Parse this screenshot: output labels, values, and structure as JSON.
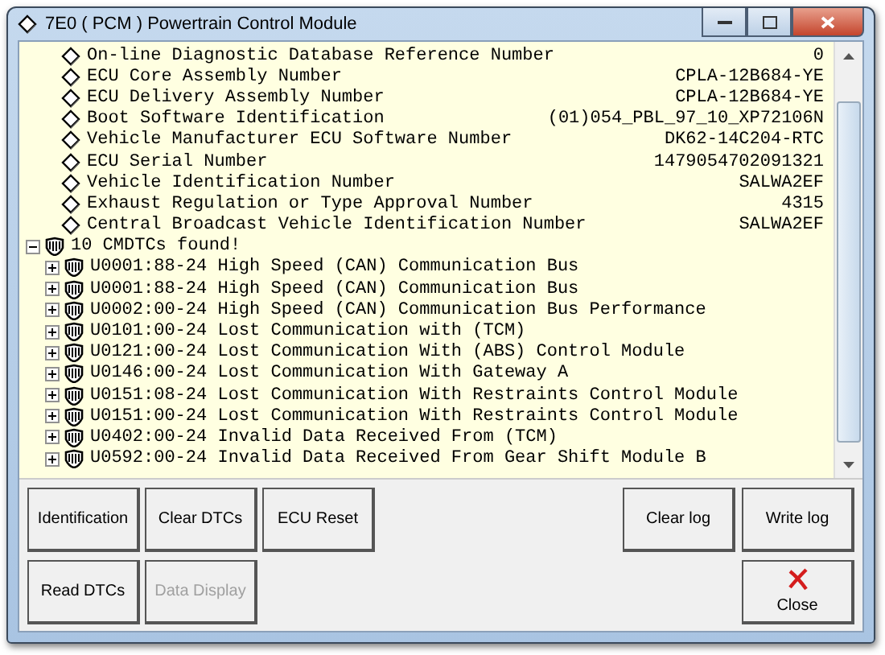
{
  "window": {
    "title": "7E0 ( PCM ) Powertrain Control Module"
  },
  "identification": [
    {
      "label": "On-line Diagnostic Database Reference Number",
      "value": "0"
    },
    {
      "label": "ECU Core Assembly Number",
      "value": "CPLA-12B684-YE"
    },
    {
      "label": "ECU Delivery Assembly Number",
      "value": "CPLA-12B684-YE"
    },
    {
      "label": "Boot Software Identification",
      "value": "(01)054_PBL_97_10_XP72106N"
    },
    {
      "label": "Vehicle Manufacturer ECU Software Number",
      "value": "DK62-14C204-RTC"
    },
    {
      "label": "ECU Serial Number",
      "value": "1479054702091321"
    },
    {
      "label": "Vehicle Identification Number",
      "value": "SALWA2EF"
    },
    {
      "label": "Exhaust Regulation or Type Approval Number",
      "value": "4315"
    },
    {
      "label": "Central Broadcast Vehicle Identification Number",
      "value": "SALWA2EF"
    }
  ],
  "dtc_group": {
    "label": "10 CMDTCs found!",
    "expanded": true,
    "children": [
      {
        "label": "U0001:88-24 High Speed (CAN) Communication Bus",
        "expanded": false
      },
      {
        "label": "U0001:88-24 High Speed (CAN) Communication Bus",
        "expanded": false
      },
      {
        "label": "U0002:00-24 High Speed (CAN) Communication Bus Performance",
        "expanded": false
      },
      {
        "label": "U0101:00-24 Lost Communication with (TCM)",
        "expanded": false
      },
      {
        "label": "U0121:00-24 Lost Communication With (ABS) Control Module",
        "expanded": false
      },
      {
        "label": "U0146:00-24 Lost Communication With Gateway A",
        "expanded": false
      },
      {
        "label": "U0151:08-24 Lost Communication With Restraints Control Module",
        "expanded": false
      },
      {
        "label": "U0151:00-24 Lost Communication With Restraints Control Module",
        "expanded": false
      },
      {
        "label": "U0402:00-24 Invalid Data Received From (TCM)",
        "expanded": false
      },
      {
        "label": "U0592:00-24 Invalid Data Received From Gear Shift Module B",
        "expanded": false
      }
    ]
  },
  "buttons_left": [
    {
      "label": "Identification",
      "disabled": false
    },
    {
      "label": "Clear DTCs",
      "disabled": false
    },
    {
      "label": "ECU Reset",
      "disabled": false
    },
    {
      "label": "Read DTCs",
      "disabled": false
    },
    {
      "label": "Data Display",
      "disabled": true
    }
  ],
  "buttons_right": [
    {
      "label": "Clear log",
      "kind": "text"
    },
    {
      "label": "Write log",
      "kind": "text"
    },
    {
      "label": "Close",
      "kind": "close"
    }
  ]
}
